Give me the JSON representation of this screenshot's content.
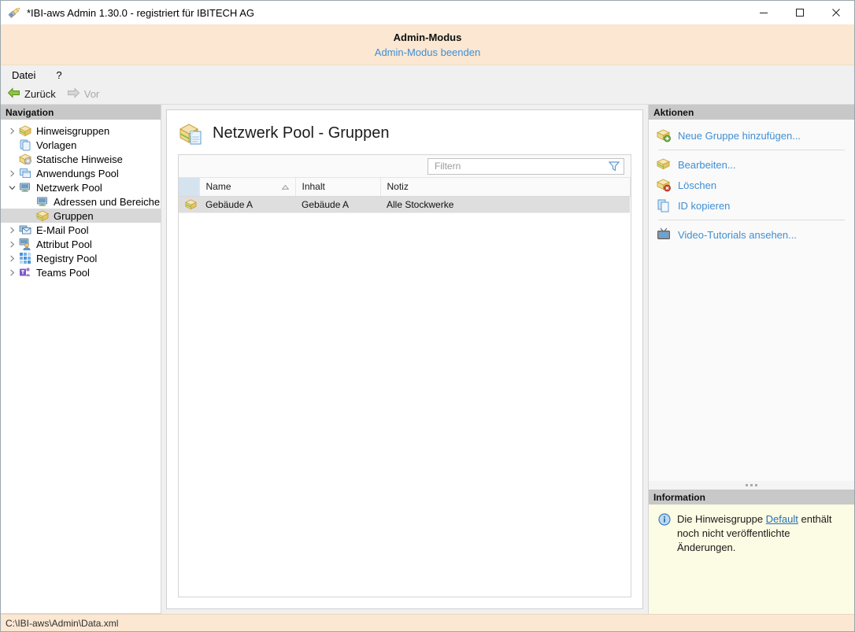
{
  "window": {
    "title": "*IBI-aws Admin 1.30.0 - registriert für IBITECH AG",
    "app_icon": "pen-document-icon",
    "minimize_label": "—",
    "maximize_label": "□",
    "close_label": "✕"
  },
  "admin_banner": {
    "title": "Admin-Modus",
    "exit_link": "Admin-Modus beenden"
  },
  "menubar": {
    "items": [
      {
        "label": "Datei"
      },
      {
        "label": "?"
      }
    ]
  },
  "navtoolbar": {
    "back": {
      "label": "Zurück",
      "icon": "arrow-left-icon",
      "enabled": true
    },
    "forward": {
      "label": "Vor",
      "icon": "arrow-right-icon",
      "enabled": false
    }
  },
  "navigation": {
    "header": "Navigation",
    "items": [
      {
        "label": "Hinweisgruppen",
        "icon": "gold-box-icon",
        "expander": "collapsed",
        "indent": 0,
        "selected": false
      },
      {
        "label": "Vorlagen",
        "icon": "blue-stack-icon",
        "expander": "none",
        "indent": 0,
        "selected": false
      },
      {
        "label": "Statische Hinweise",
        "icon": "gold-box-gear-icon",
        "expander": "none",
        "indent": 0,
        "selected": false
      },
      {
        "label": "Anwendungs Pool",
        "icon": "blue-windows-icon",
        "expander": "collapsed",
        "indent": 0,
        "selected": false
      },
      {
        "label": "Netzwerk Pool",
        "icon": "monitor-icon",
        "expander": "expanded",
        "indent": 0,
        "selected": false
      },
      {
        "label": "Adressen und Bereiche",
        "icon": "monitor-small-icon",
        "expander": "none",
        "indent": 1,
        "selected": false
      },
      {
        "label": "Gruppen",
        "icon": "gold-box-icon",
        "expander": "none",
        "indent": 1,
        "selected": true
      },
      {
        "label": "E-Mail Pool",
        "icon": "mail-icon",
        "expander": "collapsed",
        "indent": 0,
        "selected": false
      },
      {
        "label": "Attribut Pool",
        "icon": "monitor-user-icon",
        "expander": "collapsed",
        "indent": 0,
        "selected": false
      },
      {
        "label": "Registry Pool",
        "icon": "grid-blue-icon",
        "expander": "collapsed",
        "indent": 0,
        "selected": false
      },
      {
        "label": "Teams Pool",
        "icon": "teams-icon",
        "expander": "collapsed",
        "indent": 0,
        "selected": false
      }
    ]
  },
  "main": {
    "page_title": "Netzwerk Pool - Gruppen",
    "page_icon": "gold-box-document-icon",
    "filter": {
      "placeholder": "Filtern",
      "value": "",
      "icon": "funnel-icon"
    },
    "table": {
      "columns": [
        {
          "key": "icon",
          "label": "",
          "sort": "none"
        },
        {
          "key": "name",
          "label": "Name",
          "sort": "asc"
        },
        {
          "key": "inhalt",
          "label": "Inhalt",
          "sort": "none"
        },
        {
          "key": "notiz",
          "label": "Notiz",
          "sort": "none"
        }
      ],
      "rows": [
        {
          "icon": "gold-box-icon",
          "name": "Gebäude A",
          "inhalt": "Gebäude A",
          "notiz": "Alle Stockwerke",
          "selected": true
        }
      ]
    }
  },
  "actions": {
    "header": "Aktionen",
    "items": [
      {
        "label": "Neue Gruppe hinzufügen...",
        "icon": "box-add-icon",
        "separator_after": true
      },
      {
        "label": "Bearbeiten...",
        "icon": "box-edit-icon",
        "separator_after": false
      },
      {
        "label": "Löschen",
        "icon": "box-delete-icon",
        "separator_after": false
      },
      {
        "label": "ID kopieren",
        "icon": "copy-icon",
        "separator_after": true
      },
      {
        "label": "Video-Tutorials ansehen...",
        "icon": "tv-icon",
        "separator_after": false
      }
    ]
  },
  "information": {
    "header": "Information",
    "icon": "info-icon",
    "text_before": "Die Hinweisgruppe ",
    "link": "Default",
    "text_after": " enthält noch nicht veröffentlichte Änderungen."
  },
  "statusbar": {
    "path": "C:\\IBI-aws\\Admin\\Data.xml"
  },
  "colors": {
    "banner_bg": "#fbe7d2",
    "link": "#3f8fd4",
    "panel_header_bg": "#c8c8c8",
    "info_bg": "#fcfbe3",
    "selection": "#d8d8d8"
  }
}
